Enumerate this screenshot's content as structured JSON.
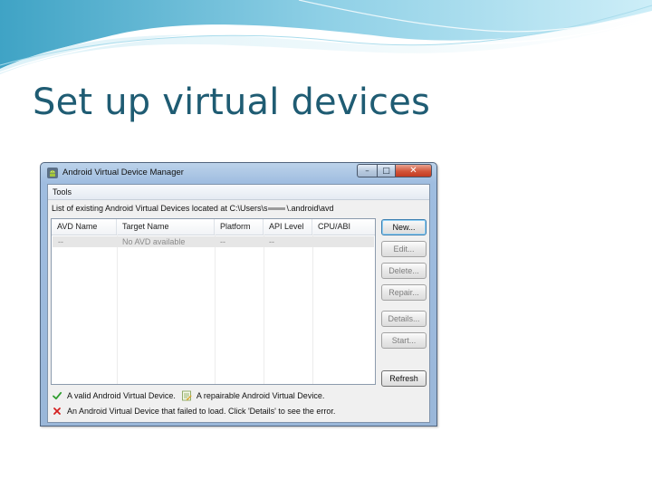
{
  "slide": {
    "title": "Set up virtual devices"
  },
  "window": {
    "title": "Android Virtual Device Manager",
    "controls": {
      "minimize": "–",
      "maximize": "□",
      "close": "✕"
    },
    "menu": [
      "Tools"
    ],
    "list_caption_before": "List of existing Android Virtual Devices located at C:\\Users\\s",
    "list_caption_after": "\\.android\\avd",
    "columns": [
      "AVD Name",
      "Target Name",
      "Platform",
      "API Level",
      "CPU/ABI"
    ],
    "rows": [
      {
        "avd_name": "--",
        "target_name": "No AVD available",
        "platform": "--",
        "api_level": "--",
        "cpu_abi": ""
      }
    ],
    "buttons": {
      "new": "New...",
      "edit": "Edit...",
      "delete": "Delete...",
      "repair": "Repair...",
      "details": "Details...",
      "start": "Start...",
      "refresh": "Refresh"
    },
    "legend": {
      "valid": "A valid Android Virtual Device.",
      "repairable": "A repairable Android Virtual Device.",
      "failed": "An Android Virtual Device that failed to load. Click 'Details' to see the error."
    }
  },
  "colors": {
    "title_text": "#1f5c73",
    "titlebar": "#9fbde0",
    "close_button": "#c9452b",
    "valid_check": "#2e9d2e",
    "failed_x": "#d42020",
    "default_button_border": "#3c7fb1"
  },
  "icons": {
    "app": "android-robot-icon",
    "valid": "green-check-icon",
    "repairable": "repair-document-icon",
    "failed": "red-x-icon"
  }
}
